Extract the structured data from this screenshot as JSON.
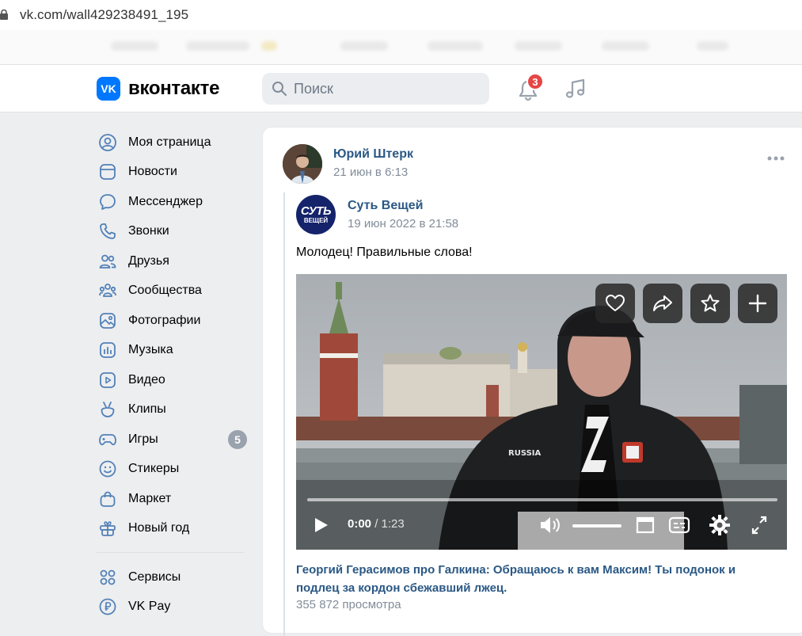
{
  "browser": {
    "url": "vk.com/wall429238491_195"
  },
  "header": {
    "logo_mark": "VK",
    "logo_text": "вконтакте",
    "search_placeholder": "Поиск",
    "notifications_count": "3"
  },
  "sidebar": {
    "items": [
      {
        "label": "Моя страница",
        "icon": "user-circle-icon"
      },
      {
        "label": "Новости",
        "icon": "news-icon"
      },
      {
        "label": "Мессенджер",
        "icon": "message-icon"
      },
      {
        "label": "Звонки",
        "icon": "phone-icon"
      },
      {
        "label": "Друзья",
        "icon": "friends-icon"
      },
      {
        "label": "Сообщества",
        "icon": "communities-icon"
      },
      {
        "label": "Фотографии",
        "icon": "photo-icon"
      },
      {
        "label": "Музыка",
        "icon": "music-icon"
      },
      {
        "label": "Видео",
        "icon": "video-icon"
      },
      {
        "label": "Клипы",
        "icon": "clips-icon"
      },
      {
        "label": "Игры",
        "icon": "gamepad-icon",
        "badge": "5"
      },
      {
        "label": "Стикеры",
        "icon": "smile-icon"
      },
      {
        "label": "Маркет",
        "icon": "bag-icon"
      },
      {
        "label": "Новый год",
        "icon": "gift-icon"
      },
      {
        "label": "Сервисы",
        "icon": "services-icon"
      },
      {
        "label": "VK Pay",
        "icon": "ruble-icon"
      }
    ]
  },
  "post": {
    "author": "Юрий Штерк",
    "date": "21 июн в 6:13",
    "repost": {
      "group_name": "Суть Вещей",
      "group_avatar_line1": "СУТЬ",
      "group_avatar_line2": "ВЕЩЕЙ",
      "date": "19 июн 2022 в 21:58",
      "text": "Молодец! Правильные слова!"
    },
    "video": {
      "current_time": "0:00",
      "separator": " / ",
      "duration": "1:23",
      "shirt_text": "RUSSIA",
      "title": "Георгий Герасимов про Галкина: Обращаюсь к вам Максим! Ты подонок и подлец за кордон сбежавший лжец.",
      "views": "355 872 просмотра"
    }
  },
  "colors": {
    "accent": "#0077ff",
    "link": "#2a5885",
    "badge_red": "#e64646",
    "badge_gray": "#99a2ad"
  }
}
